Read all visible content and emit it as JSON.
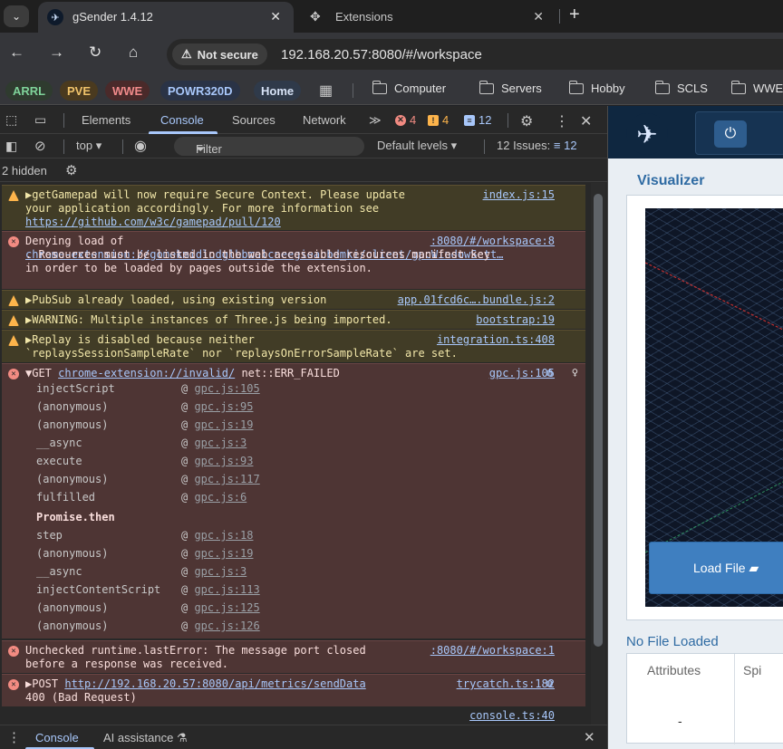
{
  "browser": {
    "tabs": [
      {
        "title": "gSender 1.4.12",
        "icon": "gsender-icon",
        "active": true
      },
      {
        "title": "Extensions",
        "icon": "puzzle-icon",
        "active": false
      }
    ],
    "security_label": "Not secure",
    "url": "192.168.20.57:8080/#/workspace",
    "bookmarks_pills": [
      {
        "label": "ARRL",
        "bg": "#2f3b2f",
        "fg": "#7fd39a"
      },
      {
        "label": "PVE",
        "bg": "#4a3a1f",
        "fg": "#f0c36a"
      },
      {
        "label": "WWE",
        "bg": "#4a2a2a",
        "fg": "#f08a8a"
      },
      {
        "label": "POWR320D",
        "bg": "#2a3346",
        "fg": "#a8c7fa"
      },
      {
        "label": "Home",
        "bg": "#2f3a4a",
        "fg": "#d7e3f7"
      }
    ],
    "bookmarks_folders": [
      "Computer",
      "Servers",
      "Hobby",
      "SCLS",
      "WWE"
    ]
  },
  "devtools": {
    "tabs": [
      "Elements",
      "Console",
      "Sources",
      "Network"
    ],
    "active_tab": "Console",
    "error_count": "4",
    "warning_count": "4",
    "issue_count": "12",
    "context": "top",
    "filter_placeholder": "Filter",
    "levels": "Default levels",
    "issues_label": "12 Issues:",
    "issues_count": "12",
    "hidden_label": "2 hidden",
    "drawer_tabs": [
      "Console",
      "AI assistance"
    ]
  },
  "console": {
    "messages": [
      {
        "level": "warn",
        "text": "▶getGamepad will now require Secure Context. Please update\nyour application accordingly. For more information see",
        "link": "https://github.com/w3c/gamepad/pull/120",
        "source": "index.js:15"
      },
      {
        "level": "err",
        "text": "Denying load of",
        "link": "chrome-extension://gomekmidlodglbbmalcneegieacbdmki/client/gpcWindowSett…",
        "text2": ". Resources must be listed in the web_accessible_resources manifest key\nin order to be loaded by pages outside the extension.",
        "source": ":8080/#/workspace:8"
      },
      {
        "level": "warn",
        "text": "▶PubSub already loaded, using existing version",
        "source": "app.01fcd6c….bundle.js:2"
      },
      {
        "level": "warn",
        "text": "▶WARNING: Multiple instances of Three.js being imported.",
        "source": "bootstrap:19"
      },
      {
        "level": "warn",
        "text": "▶Replay is disabled because neither\n`replaysSessionSampleRate` nor `replaysOnErrorSampleRate` are set.",
        "source": "integration.ts:408"
      },
      {
        "level": "err",
        "text": "▼GET",
        "link": "chrome-extension://invalid/",
        "text2": " net::ERR_FAILED",
        "source": "gpc.js:105"
      },
      {
        "level": "err",
        "text": "Unchecked runtime.lastError: The message port closed\nbefore a response was received.",
        "source": ":8080/#/workspace:1"
      },
      {
        "level": "err",
        "text": "▶POST",
        "link": "http://192.168.20.57:8080/api/metrics/sendData",
        "text2": "\n400 (Bad Request)",
        "source": "trycatch.ts:182"
      }
    ],
    "stack": [
      {
        "fn": "injectScript",
        "loc": "gpc.js:105"
      },
      {
        "fn": "(anonymous)",
        "loc": "gpc.js:95"
      },
      {
        "fn": "(anonymous)",
        "loc": "gpc.js:19"
      },
      {
        "fn": "__async",
        "loc": "gpc.js:3"
      },
      {
        "fn": "execute",
        "loc": "gpc.js:93"
      },
      {
        "fn": "(anonymous)",
        "loc": "gpc.js:117"
      },
      {
        "fn": "fulfilled",
        "loc": "gpc.js:6"
      },
      {
        "fn": "Promise.then",
        "loc": ""
      },
      {
        "fn": "step",
        "loc": "gpc.js:18"
      },
      {
        "fn": "(anonymous)",
        "loc": "gpc.js:19"
      },
      {
        "fn": "__async",
        "loc": "gpc.js:3"
      },
      {
        "fn": "injectContentScript",
        "loc": "gpc.js:113"
      },
      {
        "fn": "(anonymous)",
        "loc": "gpc.js:125"
      },
      {
        "fn": "(anonymous)",
        "loc": "gpc.js:126"
      }
    ],
    "last_source": "console.ts:40"
  },
  "app": {
    "visualizer_title": "Visualizer",
    "load_file_label": "Load File",
    "no_file_label": "No File Loaded",
    "attributes_label": "Attributes",
    "spindle_label": "Spi",
    "dash": "-"
  }
}
